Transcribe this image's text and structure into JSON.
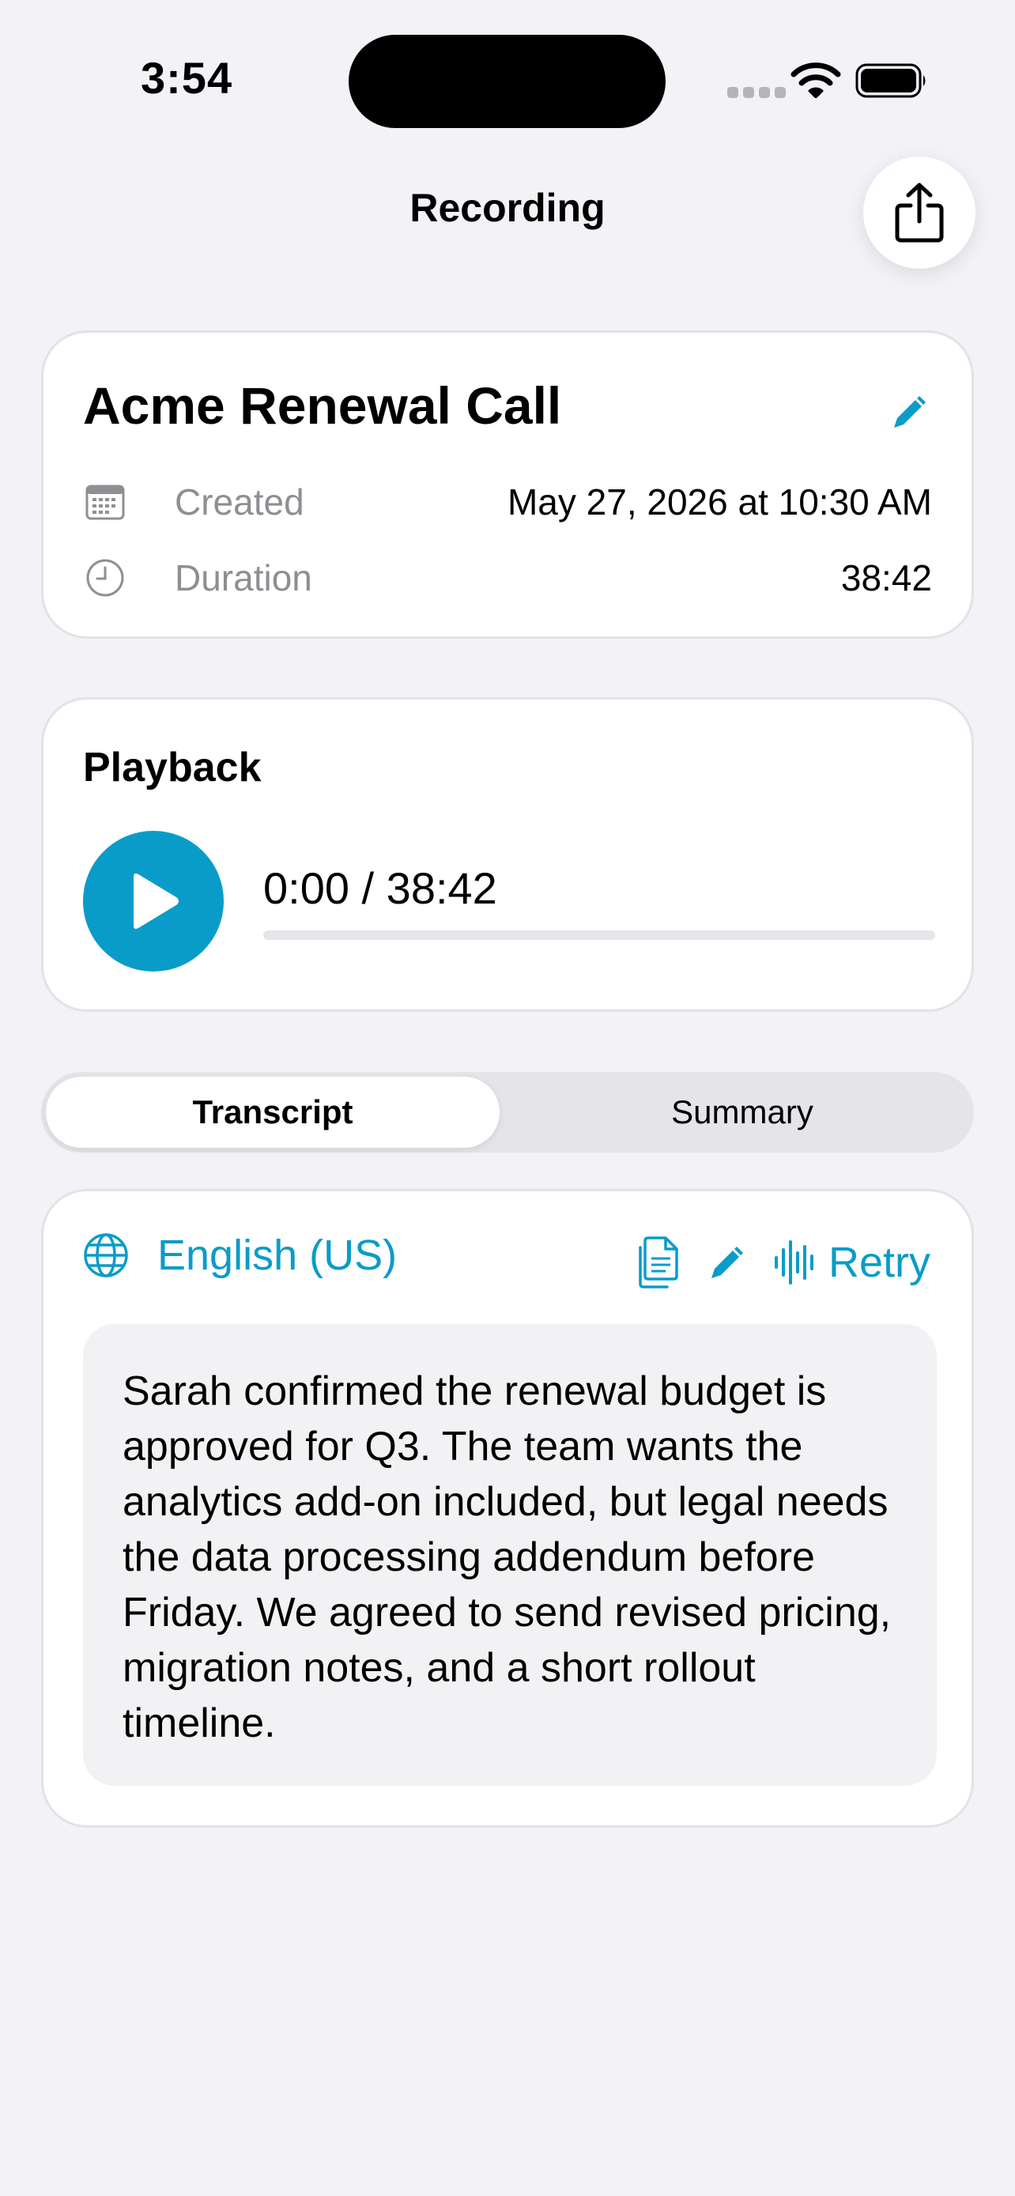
{
  "status_bar": {
    "time": "3:54"
  },
  "header": {
    "title": "Recording"
  },
  "recording": {
    "title": "Acme Renewal Call",
    "created_label": "Created",
    "created_value": "May 27, 2026 at 10:30 AM",
    "duration_label": "Duration",
    "duration_value": "38:42"
  },
  "playback": {
    "title": "Playback",
    "time_display": "0:00 / 38:42",
    "progress_percent": 0
  },
  "tabs": {
    "items": [
      {
        "label": "Transcript",
        "selected": true
      },
      {
        "label": "Summary",
        "selected": false
      }
    ]
  },
  "transcript": {
    "language": "English (US)",
    "retry_label": "Retry",
    "text": "Sarah confirmed the renewal budget is approved for Q3. The team wants the analytics add-on included, but legal needs the data processing addendum before Friday. We agreed to send revised pricing, migration notes, and a short rollout timeline."
  },
  "colors": {
    "accent": "#0A9CC8",
    "background": "#F2F2F7",
    "secondary_text": "#8E8E93"
  },
  "icons": {
    "share": "share-icon",
    "edit": "pencil-icon",
    "calendar": "calendar-icon",
    "clock": "clock-icon",
    "play": "play-icon",
    "globe": "globe-icon",
    "copy": "copy-icon",
    "waveform": "waveform-icon"
  }
}
